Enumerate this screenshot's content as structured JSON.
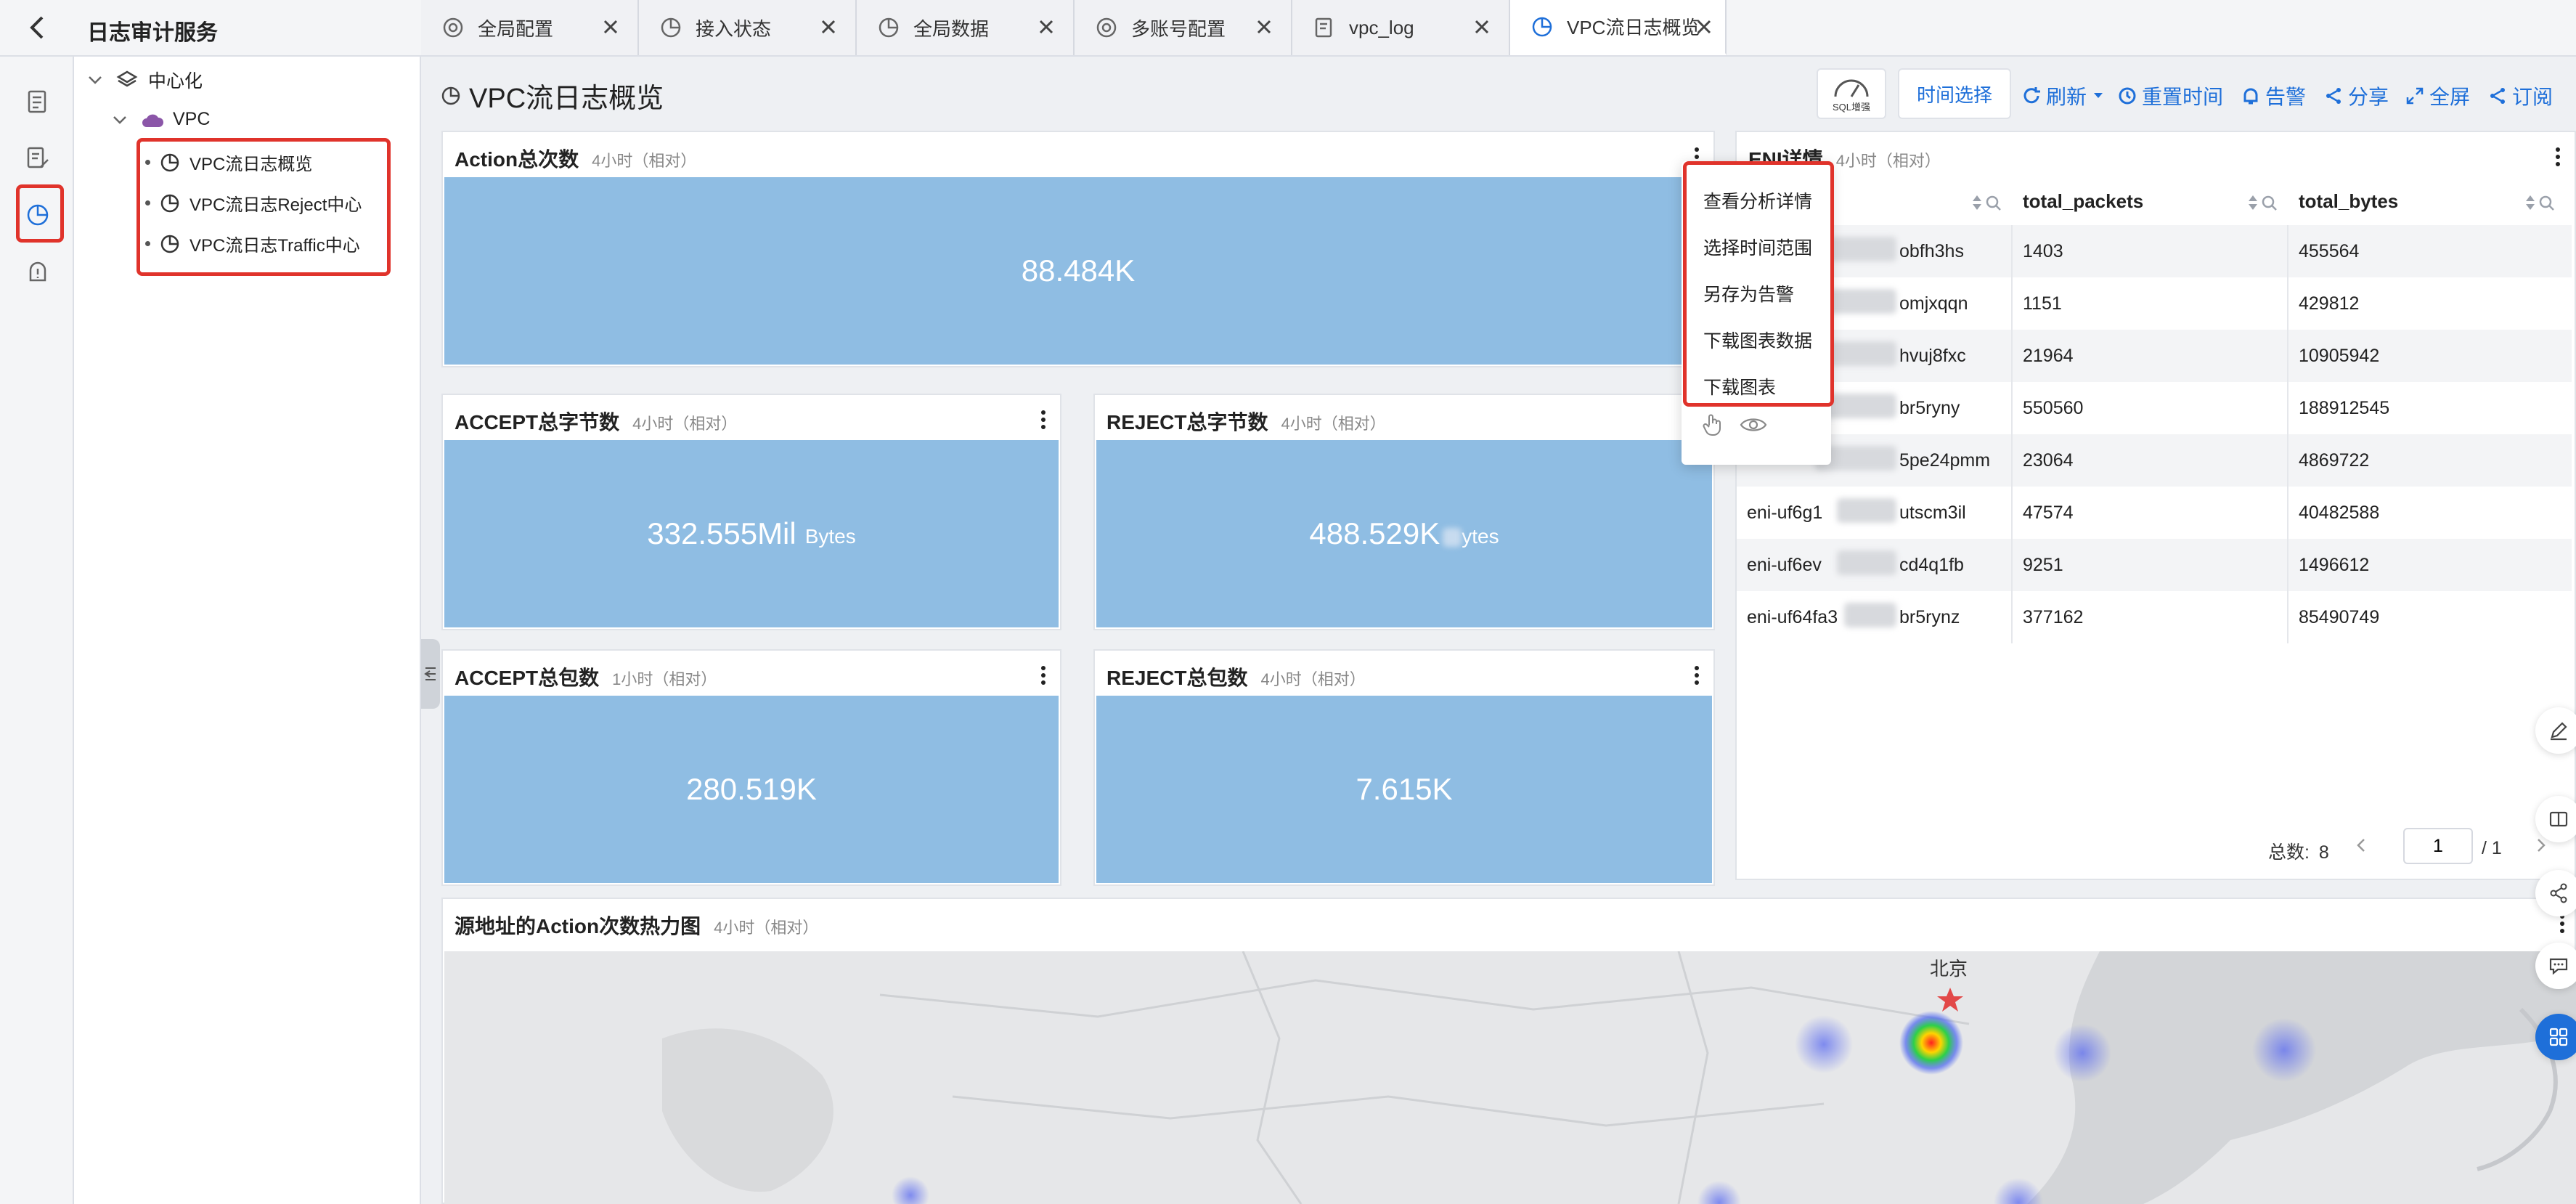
{
  "service_title": "日志审计服务",
  "tabs": [
    {
      "label": "全局配置",
      "icon": "settings-icon"
    },
    {
      "label": "接入状态",
      "icon": "pie-chart-icon"
    },
    {
      "label": "全局数据",
      "icon": "pie-chart-icon"
    },
    {
      "label": "多账号配置",
      "icon": "settings-icon"
    },
    {
      "label": "vpc_log",
      "icon": "log-icon"
    },
    {
      "label": "VPC流日志概览",
      "icon": "pie-chart-icon",
      "active": true
    }
  ],
  "tree": {
    "root": "中心化",
    "group": "VPC",
    "leaves": [
      "VPC流日志概览",
      "VPC流日志Reject中心",
      "VPC流日志Traffic中心"
    ]
  },
  "page": {
    "title": "VPC流日志概览",
    "sql_badge": "SQL增强",
    "time_select": "时间选择",
    "refresh": "刷新",
    "reset_time": "重置时间",
    "alert": "告警",
    "share": "分享",
    "fullscreen": "全屏",
    "subscribe": "订阅"
  },
  "panels": {
    "action_total": {
      "title": "Action总次数",
      "sub": "4小时（相对）",
      "value": "88.484K"
    },
    "accept_bytes": {
      "title": "ACCEPT总字节数",
      "sub": "4小时（相对）",
      "value": "332.555Mil",
      "unit": "Bytes"
    },
    "reject_bytes": {
      "title": "REJECT总字节数",
      "sub": "4小时（相对）",
      "value": "488.529K",
      "unit": "ytes"
    },
    "accept_packets": {
      "title": "ACCEPT总包数",
      "sub": "1小时（相对）",
      "value": "280.519K"
    },
    "reject_packets": {
      "title": "REJECT总包数",
      "sub": "4小时（相对）",
      "value": "7.615K"
    },
    "eni_detail": {
      "title": "ENI详情",
      "sub": "4小时（相对）"
    },
    "heatmap": {
      "title": "源地址的Action次数热力图",
      "sub": "4小时（相对）",
      "city_label": "北京"
    }
  },
  "context_menu": [
    "查看分析详情",
    "选择时间范围",
    "另存为告警",
    "下载图表数据",
    "下载图表"
  ],
  "table": {
    "columns": [
      "total_packets",
      "total_bytes"
    ],
    "rows": [
      {
        "eni_prefix": "",
        "eni_suffix": "obfh3hs",
        "packets": "1403",
        "bytes": "455564"
      },
      {
        "eni_prefix": "",
        "eni_suffix": "omjxqqn",
        "packets": "1151",
        "bytes": "429812"
      },
      {
        "eni_prefix": "",
        "eni_suffix": "hvuj8fxc",
        "packets": "21964",
        "bytes": "10905942"
      },
      {
        "eni_prefix": "",
        "eni_suffix": "br5ryny",
        "packets": "550560",
        "bytes": "188912545"
      },
      {
        "eni_prefix": "",
        "eni_suffix": "5pe24pmm",
        "packets": "23064",
        "bytes": "4869722"
      },
      {
        "eni_prefix": "eni-uf6g1",
        "eni_suffix": "utscm3il",
        "packets": "47574",
        "bytes": "40482588"
      },
      {
        "eni_prefix": "eni-uf6ev",
        "eni_suffix": "cd4q1fb",
        "packets": "9251",
        "bytes": "1496612"
      },
      {
        "eni_prefix": "eni-uf64fa3",
        "eni_suffix": "br5rynz",
        "packets": "377162",
        "bytes": "85490749"
      }
    ],
    "total_label": "总数:",
    "total_value": "8",
    "page_current": "1",
    "page_of": "/ 1"
  },
  "colors": {
    "stat_fill": "#8fbde3",
    "accent": "#1e6fd9",
    "highlight_box": "#e0332b"
  }
}
